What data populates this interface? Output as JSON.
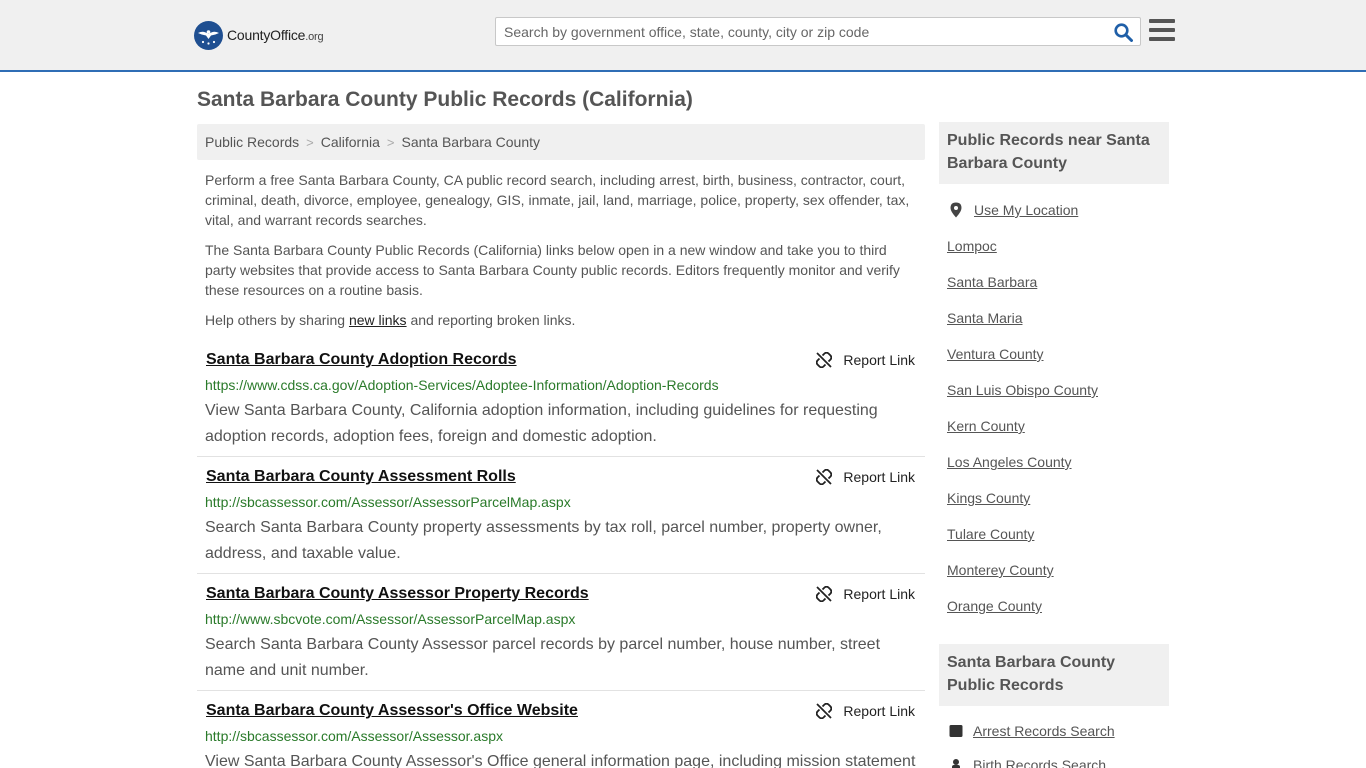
{
  "header": {
    "logo_text_main": "CountyOffice",
    "logo_text_tld": ".org",
    "search_placeholder": "Search by government office, state, county, city or zip code"
  },
  "page": {
    "title": "Santa Barbara County Public Records (California)"
  },
  "breadcrumb": [
    "Public Records",
    "California",
    "Santa Barbara County"
  ],
  "intro": {
    "p1": "Perform a free Santa Barbara County, CA public record search, including arrest, birth, business, contractor, court, criminal, death, divorce, employee, genealogy, GIS, inmate, jail, land, marriage, police, property, sex offender, tax, vital, and warrant records searches.",
    "p2": "The Santa Barbara County Public Records (California) links below open in a new window and take you to third party websites that provide access to Santa Barbara County public records. Editors frequently monitor and verify these resources on a routine basis.",
    "p3_before": "Help others by sharing ",
    "p3_link": "new links",
    "p3_after": " and reporting broken links."
  },
  "report_label": "Report Link",
  "records": [
    {
      "title": "Santa Barbara County Adoption Records",
      "url": "https://www.cdss.ca.gov/Adoption-Services/Adoptee-Information/Adoption-Records",
      "desc": "View Santa Barbara County, California adoption information, including guidelines for requesting adoption records, adoption fees, foreign and domestic adoption."
    },
    {
      "title": "Santa Barbara County Assessment Rolls",
      "url": "http://sbcassessor.com/Assessor/AssessorParcelMap.aspx",
      "desc": "Search Santa Barbara County property assessments by tax roll, parcel number, property owner, address, and taxable value."
    },
    {
      "title": "Santa Barbara County Assessor Property Records",
      "url": "http://www.sbcvote.com/Assessor/AssessorParcelMap.aspx",
      "desc": "Search Santa Barbara County Assessor parcel records by parcel number, house number, street name and unit number."
    },
    {
      "title": "Santa Barbara County Assessor's Office Website",
      "url": "http://sbcassessor.com/Assessor/Assessor.aspx",
      "desc": "View Santa Barbara County Assessor's Office general information page, including mission statement"
    }
  ],
  "sidebar": {
    "nearby_heading": "Public Records near Santa Barbara County",
    "use_location": "Use My Location",
    "nearby": [
      "Lompoc",
      "Santa Barbara",
      "Santa Maria",
      "Ventura County",
      "San Luis Obispo County",
      "Kern County",
      "Los Angeles County",
      "Kings County",
      "Tulare County",
      "Monterey County",
      "Orange County"
    ],
    "county_heading": "Santa Barbara County Public Records",
    "county_links": [
      "Arrest Records Search",
      "Birth Records Search"
    ]
  },
  "colors": {
    "accent_blue": "#2f6db5",
    "url_green": "#2a7a2a",
    "header_bg": "#f0f0f0"
  }
}
